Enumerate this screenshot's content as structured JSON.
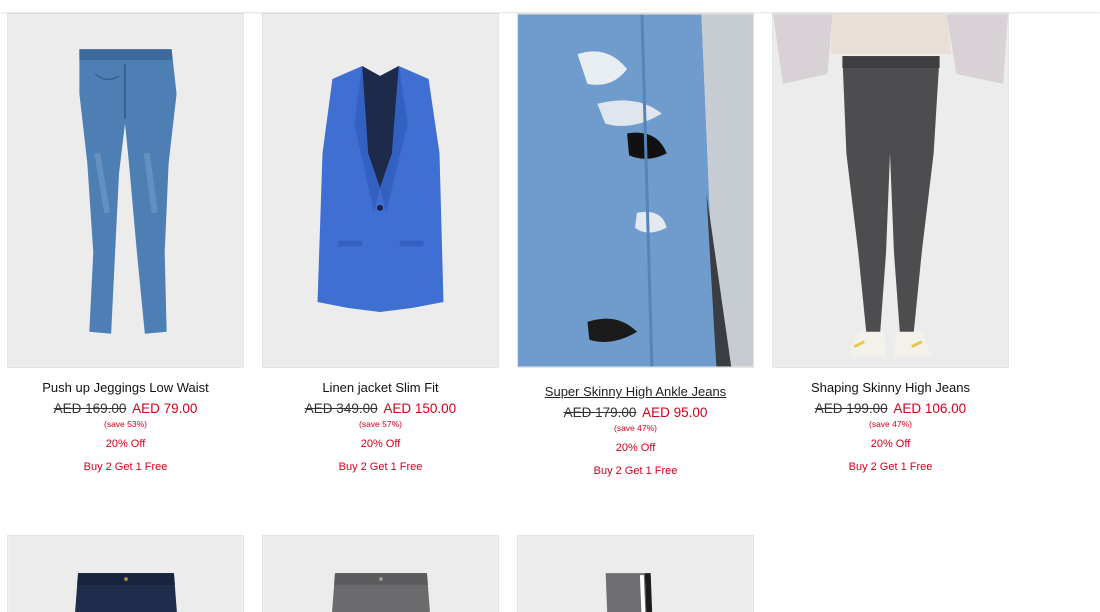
{
  "products": [
    {
      "name": "Push up Jeggings Low Waist",
      "old_price": "AED 169.00",
      "new_price": "AED 79.00",
      "save": "(save 53%)",
      "offer1": "20% Off",
      "offer2": "Buy 2 Get 1 Free",
      "image": "blue-skinny-jeans-image"
    },
    {
      "name": "Linen jacket Slim Fit",
      "old_price": "AED 349.00",
      "new_price": "AED 150.00",
      "save": "(save 57%)",
      "offer1": "20% Off",
      "offer2": "Buy 2 Get 1 Free",
      "image": "blue-linen-jacket-image"
    },
    {
      "name": "Super Skinny High Ankle Jeans",
      "old_price": "AED 179.00",
      "new_price": "AED 95.00",
      "save": "(save 47%)",
      "offer1": "20% Off",
      "offer2": "Buy 2 Get 1 Free",
      "image": "ripped-jeans-closeup-image"
    },
    {
      "name": "Shaping Skinny High Jeans",
      "old_price": "AED 199.00",
      "new_price": "AED 106.00",
      "save": "(save 47%)",
      "offer1": "20% Off",
      "offer2": "Buy 2 Get 1 Free",
      "image": "grey-skinny-jeans-model-image"
    }
  ],
  "row2_images": [
    "dark-denim-shorts-image",
    "grey-denim-shorts-image",
    "grey-sweatpants-image"
  ],
  "colors": {
    "sale_red": "#d0021b",
    "text": "#111111"
  }
}
